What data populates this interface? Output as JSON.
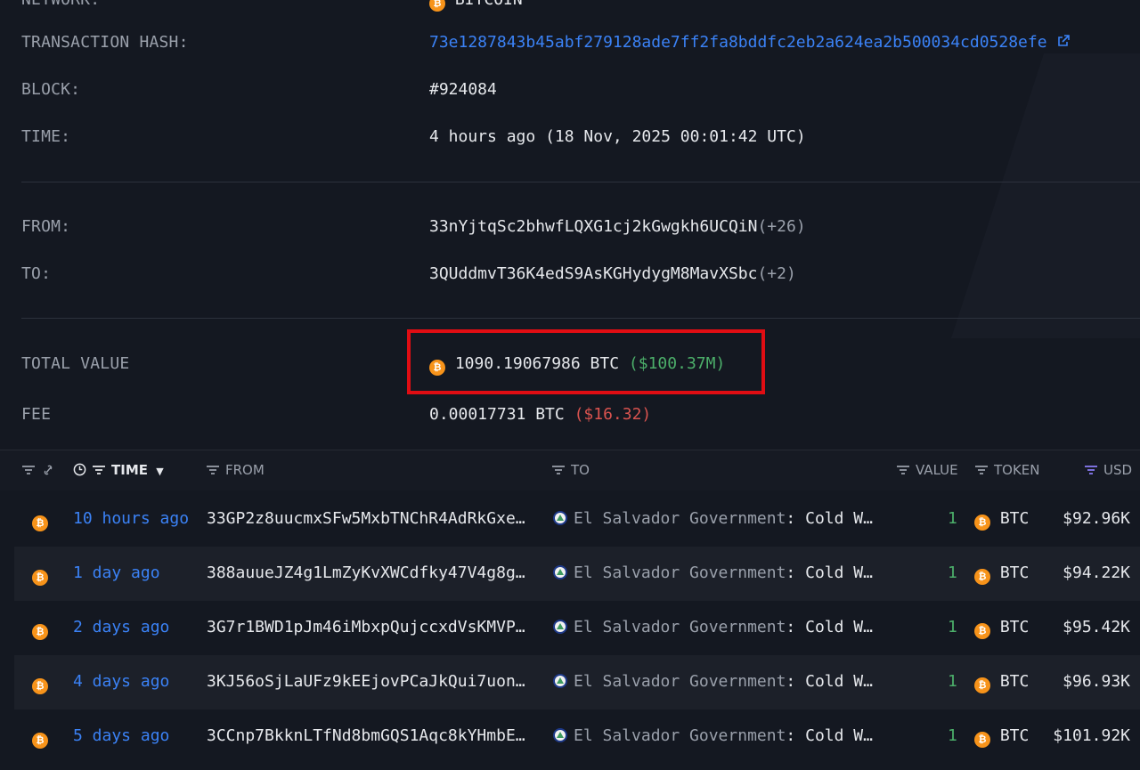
{
  "details": {
    "network": {
      "label": "NETWORK:",
      "value": "BITCOIN"
    },
    "tx_hash": {
      "label": "TRANSACTION HASH:",
      "value": "73e1287843b45abf279128ade7ff2fa8bddfc2eb2a624ea2b500034cd0528efe"
    },
    "block": {
      "label": "BLOCK:",
      "value": "#924084"
    },
    "time": {
      "label": "TIME:",
      "relative": "4 hours ago",
      "absolute": "(18 Nov, 2025 00:01:42 UTC)"
    },
    "from": {
      "label": "FROM:",
      "address": "33nYjtqSc2bhwfLQXG1cj2kGwgkh6UCQiN",
      "extra": "(+26)"
    },
    "to": {
      "label": "TO:",
      "address": "3QUddmvT36K4edS9AsKGHydygM8MavXSbc",
      "extra": "(+2)"
    },
    "total_value": {
      "label": "TOTAL VALUE",
      "amount": "1090.19067986 BTC",
      "usd": "($100.37M)"
    },
    "fee": {
      "label": "FEE",
      "amount": "0.00017731 BTC",
      "usd": "($16.32)"
    }
  },
  "table": {
    "headers": {
      "time": "TIME",
      "from": "FROM",
      "to": "TO",
      "value": "VALUE",
      "token": "TOKEN",
      "usd": "USD"
    },
    "rows": [
      {
        "time": "10 hours ago",
        "from": "33GP2z8uucmxSFw5MxbTNChR4AdRkGxe…",
        "to_entity": "El Salvador Government",
        "to_label": "Cold W…",
        "value": "1",
        "token": "BTC",
        "usd": "$92.96K"
      },
      {
        "time": "1 day ago",
        "from": "388auueJZ4g1LmZyKvXWCdfky47V4g8g…",
        "to_entity": "El Salvador Government",
        "to_label": "Cold W…",
        "value": "1",
        "token": "BTC",
        "usd": "$94.22K"
      },
      {
        "time": "2 days ago",
        "from": "3G7r1BWD1pJm46iMbxpQujccxdVsKMVP…",
        "to_entity": "El Salvador Government",
        "to_label": "Cold W…",
        "value": "1",
        "token": "BTC",
        "usd": "$95.42K"
      },
      {
        "time": "4 days ago",
        "from": "3KJ56oSjLaUFz9kEEjovPCaJkQui7uon…",
        "to_entity": "El Salvador Government",
        "to_label": "Cold W…",
        "value": "1",
        "token": "BTC",
        "usd": "$96.93K"
      },
      {
        "time": "5 days ago",
        "from": "3CCnp7BkknLTfNd8bmGQS1Aqc8kYHmbE…",
        "to_entity": "El Salvador Government",
        "to_label": "Cold W…",
        "value": "1",
        "token": "BTC",
        "usd": "$101.92K"
      }
    ]
  },
  "colors": {
    "background": "#141821",
    "link": "#3b82f6",
    "positive": "#4caf6a",
    "negative": "#d9534f",
    "bitcoin": "#f7931a",
    "highlight_box": "#e00d13"
  },
  "icons": {
    "coin": "bitcoin-icon",
    "external_link": "external-link-icon",
    "filter": "filter-icon",
    "clock": "clock-icon",
    "link": "link-icon",
    "sort": "caret-down-icon",
    "entity": "el-salvador-emblem-icon"
  }
}
